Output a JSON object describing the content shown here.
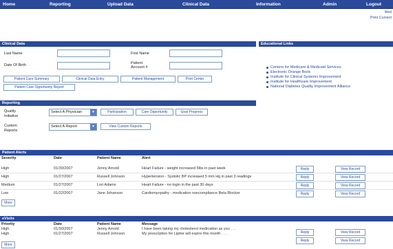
{
  "nav": {
    "items": [
      "Home",
      "Reporting",
      "Upload Data",
      "Clinical Data",
      "Information",
      "Admin",
      "Logout"
    ],
    "subtext": "Wed",
    "print_current": "Print Current"
  },
  "clinical": {
    "header": "Clinical Data",
    "last_name_label": "Last Name",
    "first_name_label": "First Name",
    "dob_label": "Date Of Birth",
    "patient_account_label_1": "Patient",
    "patient_account_label_2": "Account #",
    "buttons": [
      "Patient Care Summary",
      "Clinical Data Entry",
      "Patient Management",
      "Print Center"
    ],
    "opportunity_button": "Patient Care Opportunity Report"
  },
  "educational": {
    "header": "Educational Links",
    "links": [
      "Centers for Medicare & Medicaid Services",
      "Electronic Orange Book",
      "Institute for Clinical Systems Improvement",
      "Institute for Healthcare Improvement",
      "National Diabetes Quality Improvement Alliance"
    ]
  },
  "reporting": {
    "header": "Reporting",
    "quality_label_1": "Quality",
    "quality_label_2": "Initiative",
    "physician_select": "Select A Physician",
    "quality_buttons": [
      "Participation",
      "Care Opportunity",
      "Goal Progress"
    ],
    "custom_label_1": "Custom",
    "custom_label_2": "Reports",
    "report_select": "Select A Report",
    "view_custom": "View Custom Reports"
  },
  "alerts": {
    "header": "Patient Alerts",
    "columns": [
      "Severity",
      "Date",
      "Patient Name",
      "Alert"
    ],
    "rows": [
      {
        "severity": "High",
        "date": "01/30/2007",
        "name": "Jenny Arnold",
        "alert": "Heart Failure - weight increased 5lbs in past week",
        "reply": "Reply",
        "view": "View Record"
      },
      {
        "severity": "High",
        "date": "01/27/2007",
        "name": "Russell Johnson",
        "alert": "Hypertension - Systolic BP increased 5 mm Hg in past 3 readings",
        "reply": "Reply",
        "view": "View Record"
      },
      {
        "severity": "Medium",
        "date": "01/27/2007",
        "name": "Lori Adams",
        "alert": "Heart Failure - no login in the past 30 days",
        "reply": "Reply",
        "view": "View Record"
      },
      {
        "severity": "Low",
        "date": "01/22/2007",
        "name": "Jane Johanson",
        "alert": "Cardiomyopathy - medication noncompliance Beta Blocker",
        "reply": "Reply",
        "view": "View Record"
      }
    ],
    "more": "More"
  },
  "evisits": {
    "header": "eVisits",
    "columns": [
      "Priority",
      "Date",
      "Patient Name",
      "Message"
    ],
    "rows": [
      {
        "priority": "High",
        "date": "01/30/2007",
        "name": "Jenny Arnold",
        "message": "I have been taking my cholesterol medication as you . . .",
        "reply": "Reply",
        "view": "View Record"
      },
      {
        "priority": "High",
        "date": "01/27/2007",
        "name": "Russell Johnson",
        "message": "My prescription for Lipitor will expire this month . . .",
        "reply": "Reply",
        "view": "View Record"
      }
    ],
    "more": "More"
  }
}
